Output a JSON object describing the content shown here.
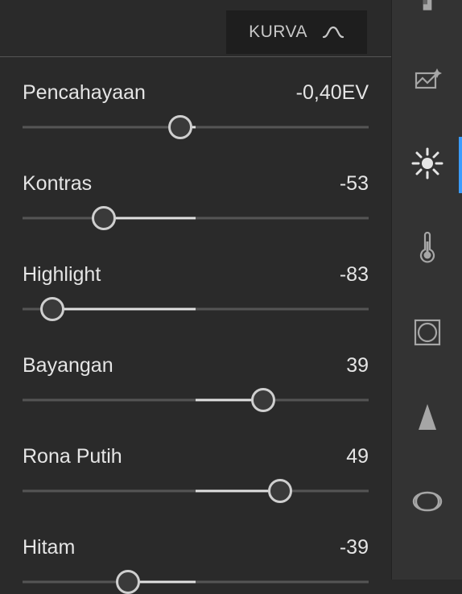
{
  "header": {
    "kurva_label": "KURVA"
  },
  "sliders": [
    {
      "label": "Pencahayaan",
      "value_display": "-0,40EV",
      "value": -0.4,
      "min": -5,
      "max": 5,
      "thumb_pct": 45.5,
      "fill_from_pct": 45.5,
      "fill_to_pct": 50
    },
    {
      "label": "Kontras",
      "value_display": "-53",
      "value": -53,
      "min": -100,
      "max": 100,
      "thumb_pct": 23.5,
      "fill_from_pct": 23.5,
      "fill_to_pct": 50
    },
    {
      "label": "Highlight",
      "value_display": "-83",
      "value": -83,
      "min": -100,
      "max": 100,
      "thumb_pct": 8.5,
      "fill_from_pct": 8.5,
      "fill_to_pct": 50
    },
    {
      "label": "Bayangan",
      "value_display": "39",
      "value": 39,
      "min": -100,
      "max": 100,
      "thumb_pct": 69.5,
      "fill_from_pct": 50,
      "fill_to_pct": 69.5
    },
    {
      "label": "Rona Putih",
      "value_display": "49",
      "value": 49,
      "min": -100,
      "max": 100,
      "thumb_pct": 74.5,
      "fill_from_pct": 50,
      "fill_to_pct": 74.5
    },
    {
      "label": "Hitam",
      "value_display": "-39",
      "value": -39,
      "min": -100,
      "max": 100,
      "thumb_pct": 30.5,
      "fill_from_pct": 30.5,
      "fill_to_pct": 50
    }
  ],
  "rail_icons": [
    {
      "name": "crop-icon",
      "active": false
    },
    {
      "name": "auto-enhance-icon",
      "active": false
    },
    {
      "name": "light-icon",
      "active": true
    },
    {
      "name": "temperature-icon",
      "active": false
    },
    {
      "name": "vignette-icon",
      "active": false
    },
    {
      "name": "sharpen-icon",
      "active": false
    },
    {
      "name": "lens-icon",
      "active": false
    }
  ]
}
